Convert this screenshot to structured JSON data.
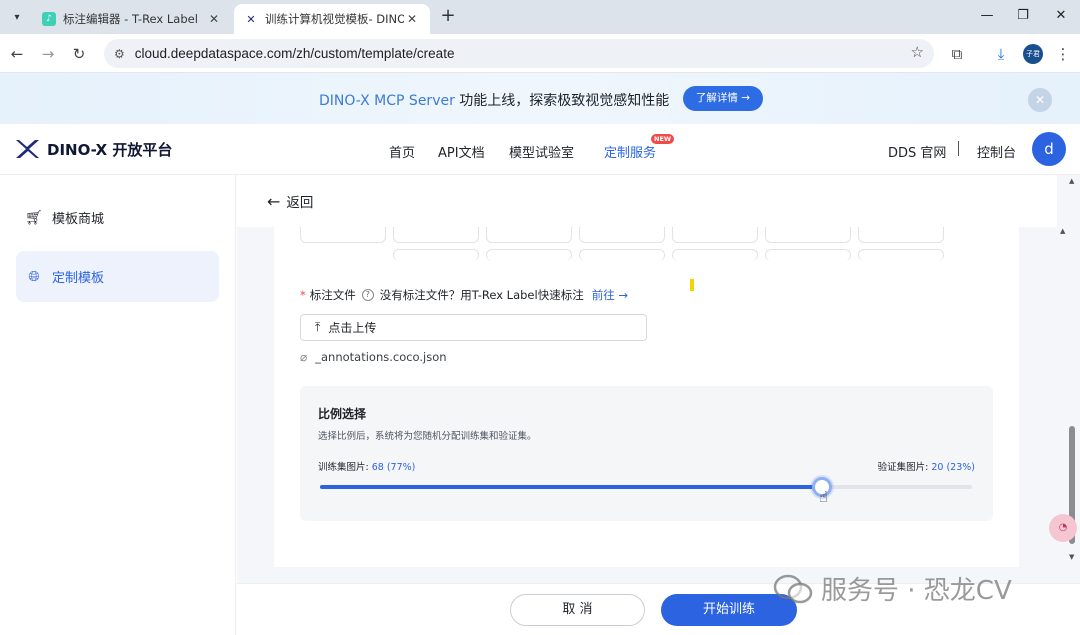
{
  "browser": {
    "tabs": [
      {
        "title": "标注编辑器 - T-Rex Label",
        "icon": "trex-label-favicon",
        "active": false
      },
      {
        "title": "训练计算机视觉模板- DINO-X",
        "icon": "dino-x-favicon",
        "active": true
      }
    ],
    "url": "cloud.deepdataspace.com/zh/custom/template/create",
    "profile_label": "子君"
  },
  "banner": {
    "highlight": "DINO-X MCP Server",
    "text": " 功能上线，探索极致视觉感知性能",
    "button": "了解详情 →"
  },
  "header": {
    "logo_text": "DINO-X 开放平台",
    "nav": [
      "首页",
      "API文档",
      "模型试验室",
      "定制服务"
    ],
    "new_badge": "NEW",
    "dds_link": "DDS 官网",
    "console_link": "控制台",
    "user_initial": "d"
  },
  "sidebar": {
    "items": [
      {
        "label": "模板商城",
        "icon": "cart-icon",
        "active": false
      },
      {
        "label": "定制模板",
        "icon": "globe-icon",
        "active": true
      }
    ]
  },
  "main": {
    "back_label": "返回",
    "annotation": {
      "required_mark": "*",
      "label": "标注文件",
      "prompt": "没有标注文件？用T-Rex Label快速标注",
      "link": "前往 →",
      "upload_button": "点击上传",
      "file_name": "_annotations.coco.json"
    },
    "ratio": {
      "title": "比例选择",
      "description": "选择比例后，系统将为您随机分配训练集和验证集。",
      "train_label": "训练集图片: ",
      "train_value": "68 (77%)",
      "val_label": "验证集图片: ",
      "val_value": "20 (23%)",
      "train_fraction": 0.77
    },
    "cancel_button": "取 消",
    "start_button": "开始训练"
  },
  "watermark": "服务号 · 恐龙CV",
  "colors": {
    "accent": "#2b63e1",
    "banner_button": "#2e6ce4",
    "required": "#f04b4b"
  }
}
